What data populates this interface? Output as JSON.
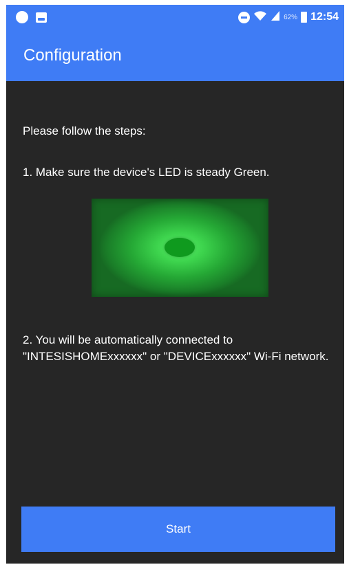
{
  "status_bar": {
    "left_icons": [
      "circle-notification-icon",
      "photo-notification-icon"
    ],
    "right_icons": [
      "do-not-disturb-icon",
      "wifi-icon",
      "signal-icon",
      "battery-icon"
    ],
    "battery_percent": "62%",
    "time": "12:54"
  },
  "app_bar": {
    "title": "Configuration"
  },
  "main": {
    "intro": "Please follow the steps:",
    "step1": "1. Make sure the device's LED is steady Green.",
    "led_image": {
      "description_color": "green"
    },
    "step2": "2. You will be automatically connected to \"INTESISHOMExxxxxx\" or \"DEVICExxxxxx\" Wi-Fi network."
  },
  "footer": {
    "start_label": "Start"
  },
  "colors": {
    "primary": "#3f7cf5",
    "background": "#262626",
    "led": "#0f9a1e"
  }
}
